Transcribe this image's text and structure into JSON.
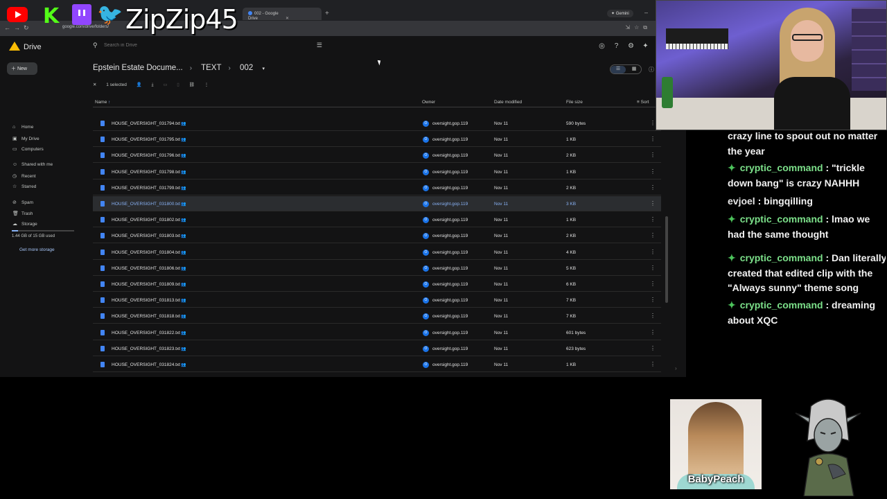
{
  "overlay": {
    "handle": "ZipZip45",
    "logos": [
      "youtube-logo",
      "kick-logo",
      "twitch-logo",
      "twitter-logo"
    ]
  },
  "browser": {
    "tabs": [
      {
        "title": "002 - Google Drive",
        "active": true
      }
    ],
    "new_tab": "+",
    "gemini_label": "Gemini",
    "url": "google.com/drive/folders/"
  },
  "drive": {
    "app_name": "Drive",
    "search": {
      "placeholder": "Search in Drive"
    },
    "new_label": "New",
    "nav": [
      {
        "label": "Home",
        "icon": "home-icon",
        "glyph": "⌂"
      },
      {
        "label": "My Drive",
        "icon": "drive-icon",
        "glyph": "▣"
      },
      {
        "label": "Computers",
        "icon": "computer-icon",
        "glyph": "▭"
      },
      {
        "label": "Shared with me",
        "icon": "people-icon",
        "glyph": "☺"
      },
      {
        "label": "Recent",
        "icon": "clock-icon",
        "glyph": "◷"
      },
      {
        "label": "Starred",
        "icon": "star-icon",
        "glyph": "☆"
      },
      {
        "label": "Spam",
        "icon": "spam-icon",
        "glyph": "⊘"
      },
      {
        "label": "Trash",
        "icon": "trash-icon",
        "glyph": "🗑"
      },
      {
        "label": "Storage",
        "icon": "cloud-icon",
        "glyph": "☁"
      }
    ],
    "storage": {
      "text": "1.44 GB of 15 GB used",
      "used_fraction": 0.096,
      "cta": "Get more storage"
    },
    "breadcrumb": [
      "Epstein Estate Docume...",
      "TEXT",
      "002"
    ],
    "selection": {
      "label": "1 selected"
    },
    "columns": {
      "name": "Name",
      "owner": "Owner",
      "modified": "Date modified",
      "size": "File size",
      "sort": "Sort"
    },
    "files": [
      {
        "name": "HOUSE_OVERSIGHT_031794.txt",
        "owner": "oversight.gop.119",
        "modified": "Nov 11",
        "size": "590 bytes",
        "selected": false
      },
      {
        "name": "HOUSE_OVERSIGHT_031795.txt",
        "owner": "oversight.gop.119",
        "modified": "Nov 11",
        "size": "1 KB",
        "selected": false
      },
      {
        "name": "HOUSE_OVERSIGHT_031796.txt",
        "owner": "oversight.gop.119",
        "modified": "Nov 11",
        "size": "2 KB",
        "selected": false
      },
      {
        "name": "HOUSE_OVERSIGHT_031798.txt",
        "owner": "oversight.gop.119",
        "modified": "Nov 11",
        "size": "1 KB",
        "selected": false
      },
      {
        "name": "HOUSE_OVERSIGHT_031799.txt",
        "owner": "oversight.gop.119",
        "modified": "Nov 11",
        "size": "2 KB",
        "selected": false
      },
      {
        "name": "HOUSE_OVERSIGHT_031800.txt",
        "owner": "oversight.gop.119",
        "modified": "Nov 11",
        "size": "3 KB",
        "selected": true
      },
      {
        "name": "HOUSE_OVERSIGHT_031802.txt",
        "owner": "oversight.gop.119",
        "modified": "Nov 11",
        "size": "1 KB",
        "selected": false
      },
      {
        "name": "HOUSE_OVERSIGHT_031803.txt",
        "owner": "oversight.gop.119",
        "modified": "Nov 11",
        "size": "2 KB",
        "selected": false
      },
      {
        "name": "HOUSE_OVERSIGHT_031804.txt",
        "owner": "oversight.gop.119",
        "modified": "Nov 11",
        "size": "4 KB",
        "selected": false
      },
      {
        "name": "HOUSE_OVERSIGHT_031806.txt",
        "owner": "oversight.gop.119",
        "modified": "Nov 11",
        "size": "5 KB",
        "selected": false
      },
      {
        "name": "HOUSE_OVERSIGHT_031809.txt",
        "owner": "oversight.gop.119",
        "modified": "Nov 11",
        "size": "6 KB",
        "selected": false
      },
      {
        "name": "HOUSE_OVERSIGHT_031813.txt",
        "owner": "oversight.gop.119",
        "modified": "Nov 11",
        "size": "7 KB",
        "selected": false
      },
      {
        "name": "HOUSE_OVERSIGHT_031818.txt",
        "owner": "oversight.gop.119",
        "modified": "Nov 11",
        "size": "7 KB",
        "selected": false
      },
      {
        "name": "HOUSE_OVERSIGHT_031822.txt",
        "owner": "oversight.gop.119",
        "modified": "Nov 11",
        "size": "601 bytes",
        "selected": false
      },
      {
        "name": "HOUSE_OVERSIGHT_031823.txt",
        "owner": "oversight.gop.119",
        "modified": "Nov 11",
        "size": "623 bytes",
        "selected": false
      },
      {
        "name": "HOUSE_OVERSIGHT_031824.txt",
        "owner": "oversight.gop.119",
        "modified": "Nov 11",
        "size": "1 KB",
        "selected": false
      }
    ]
  },
  "chat": {
    "messages": [
      {
        "user": "",
        "text": "crazy line to spout out no matter the year",
        "gem": false
      },
      {
        "user": "cryptic_command",
        "text": "\"trickle down bang\" is crazy NAHHH",
        "gem": true
      },
      {
        "user": "evjoel",
        "text": "bingqilling",
        "gem": false
      },
      {
        "user": "cryptic_command",
        "text": "lmao we had the same thought",
        "gem": true
      },
      {
        "user": "cryptic_command",
        "text": "Dan literally created that edited clip with the \"Always sunny\" theme song",
        "gem": true
      },
      {
        "user": "cryptic_command",
        "text": "dreaming about XQC",
        "gem": true
      }
    ]
  },
  "guest_cam": {
    "label": "BabyPeach"
  }
}
